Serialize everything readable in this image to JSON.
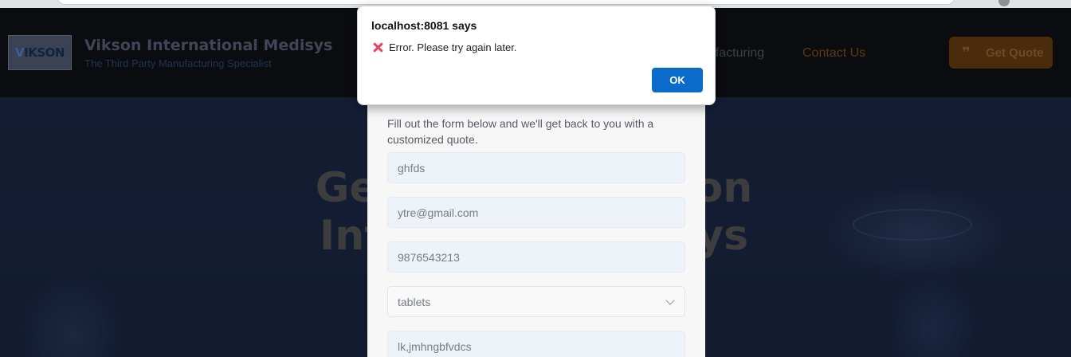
{
  "header": {
    "brand_name": "Vikson International Medisys",
    "tagline": "The Third Party Manufacturing Specialist",
    "logo_text_v": "V",
    "logo_text_rest": "IKSON",
    "nav": {
      "manufacturing": "nufacturing",
      "contact": "Contact Us"
    },
    "get_quote": {
      "icon": "quote-icon",
      "label": "Get Quote"
    }
  },
  "hero": {
    "title_line1": "Get i               kson",
    "title_line2": "Inte                  sys"
  },
  "form": {
    "intro": "Fill out the form below and we'll get back to you with a customized quote.",
    "name_value": "ghfds",
    "email_value": "ytre@gmail.com",
    "phone_value": "9876543213",
    "product_selected": "tablets",
    "message_value": "lk,jmhngbfvdcs"
  },
  "alert": {
    "title": "localhost:8081 says",
    "message": "Error. Please try again later.",
    "ok_label": "OK",
    "icon": "cross-mark-icon"
  },
  "colors": {
    "navbar_bg": "#0b0c10",
    "hero_bg": "#131c31",
    "accent_button": "#0b6bcb",
    "quote_button_bg": "#4a2b0c",
    "error_icon": "#e5445f"
  }
}
